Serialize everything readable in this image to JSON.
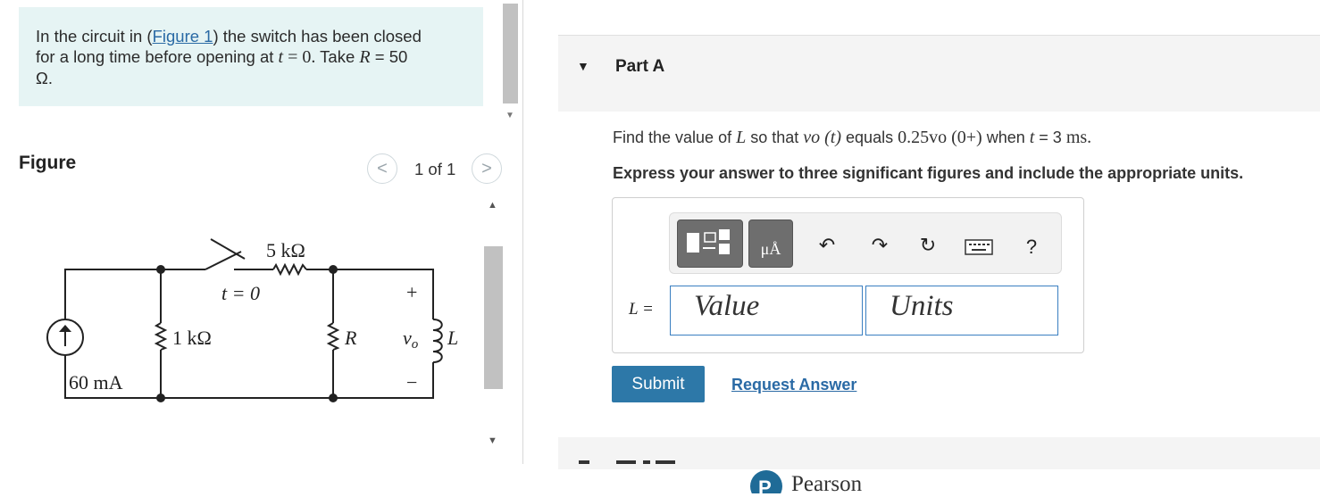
{
  "problem": {
    "text_1": "In the circuit in (",
    "figure_link": "Figure 1",
    "text_2": ") the switch has been closed",
    "text_3": "for a long time before opening at ",
    "time_var": "t",
    "time_eq": " = 0.",
    "text_4": " Take ",
    "r_var": "R",
    "r_value": " = 50",
    "text_5": "Ω."
  },
  "figure": {
    "title": "Figure",
    "pager": "1 of 1",
    "prev_icon": "<",
    "next_icon": ">",
    "labels": {
      "resistor_5k": "5 kΩ",
      "switch_time": "t = 0",
      "resistor_1k": "1 kΩ",
      "resistor_r": "R",
      "plus": "+",
      "minus": "−",
      "vo": "v",
      "vo_sub": "o",
      "inductor": "L",
      "source": "60 mA"
    }
  },
  "part_a": {
    "title": "Part A",
    "question_1": "Find the value of ",
    "question_L": "L",
    "question_2": " so that ",
    "question_vo": "vo (t)",
    "question_3": " equals ",
    "question_expr": "0.25vo (0+)",
    "question_4": " when ",
    "question_t": "t",
    "question_5": " = 3 ",
    "question_ms": "ms.",
    "instruction": "Express your answer to three significant figures and include the appropriate units.",
    "variable_label": "L =",
    "value_placeholder": "Value",
    "units_placeholder": "Units",
    "units_button_label": "μÅ",
    "help_label": "?",
    "submit_label": "Submit",
    "request_label": "Request Answer"
  },
  "footer": {
    "brand": "Pearson",
    "brand_letter": "P"
  },
  "colors": {
    "problem_bg": "#e6f4f4",
    "link": "#2a6aa5",
    "submit_bg": "#2d78a8",
    "input_border": "#3a7fc1"
  },
  "icons": [
    "figure-prev-icon",
    "figure-next-icon",
    "caret-down-icon",
    "template-icon",
    "units-icon",
    "undo-icon",
    "redo-icon",
    "reset-icon",
    "keyboard-icon",
    "help-icon",
    "pearson-logo-icon"
  ]
}
